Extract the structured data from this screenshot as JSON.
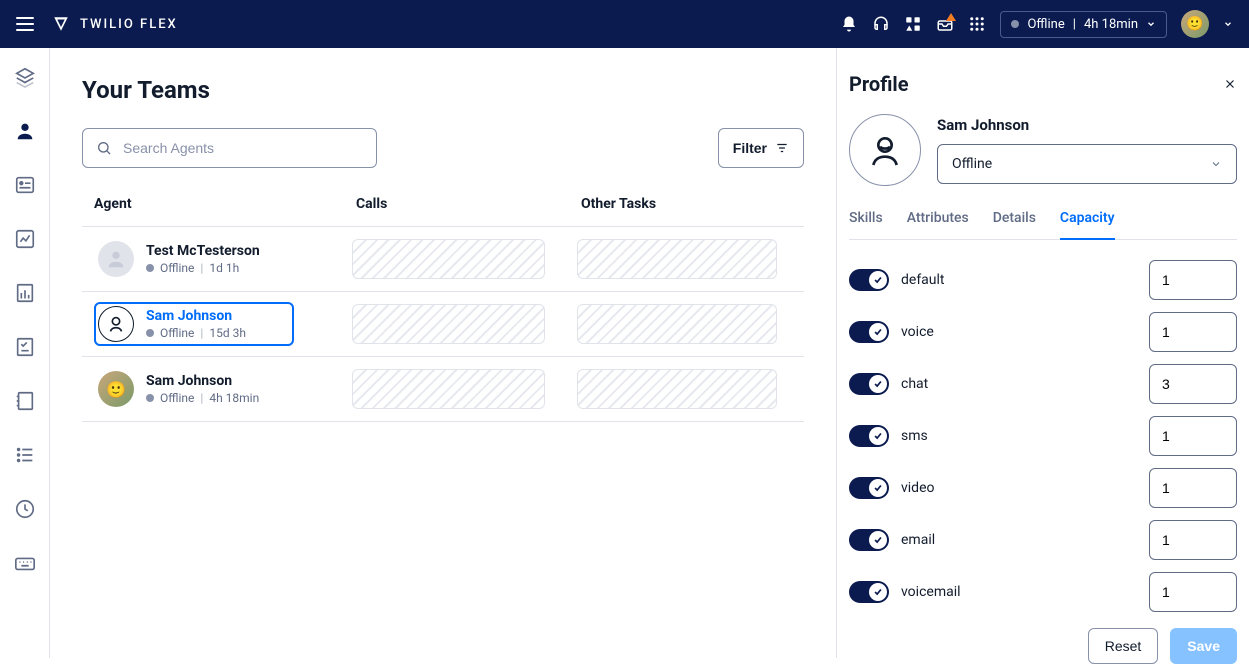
{
  "header": {
    "brand": "TWILIO FLEX",
    "status_label": "Offline",
    "status_duration": "4h 18min"
  },
  "page": {
    "title": "Your Teams",
    "search_placeholder": "Search Agents",
    "filter_label": "Filter",
    "columns": {
      "agent": "Agent",
      "calls": "Calls",
      "other": "Other Tasks"
    }
  },
  "agents": [
    {
      "name": "Test McTesterson",
      "status": "Offline",
      "duration": "1d 1h",
      "avatar": "placeholder",
      "selected": false
    },
    {
      "name": "Sam Johnson",
      "status": "Offline",
      "duration": "15d 3h",
      "avatar": "outline",
      "selected": true
    },
    {
      "name": "Sam Johnson",
      "status": "Offline",
      "duration": "4h 18min",
      "avatar": "photo",
      "selected": false
    }
  ],
  "profile": {
    "title": "Profile",
    "name": "Sam Johnson",
    "status": "Offline",
    "tabs": {
      "skills": "Skills",
      "attributes": "Attributes",
      "details": "Details",
      "capacity": "Capacity"
    },
    "active_tab": "capacity",
    "capacities": [
      {
        "label": "default",
        "value": "1",
        "on": true
      },
      {
        "label": "voice",
        "value": "1",
        "on": true
      },
      {
        "label": "chat",
        "value": "3",
        "on": true
      },
      {
        "label": "sms",
        "value": "1",
        "on": true
      },
      {
        "label": "video",
        "value": "1",
        "on": true
      },
      {
        "label": "email",
        "value": "1",
        "on": true
      },
      {
        "label": "voicemail",
        "value": "1",
        "on": true
      }
    ],
    "buttons": {
      "reset": "Reset",
      "save": "Save"
    }
  }
}
